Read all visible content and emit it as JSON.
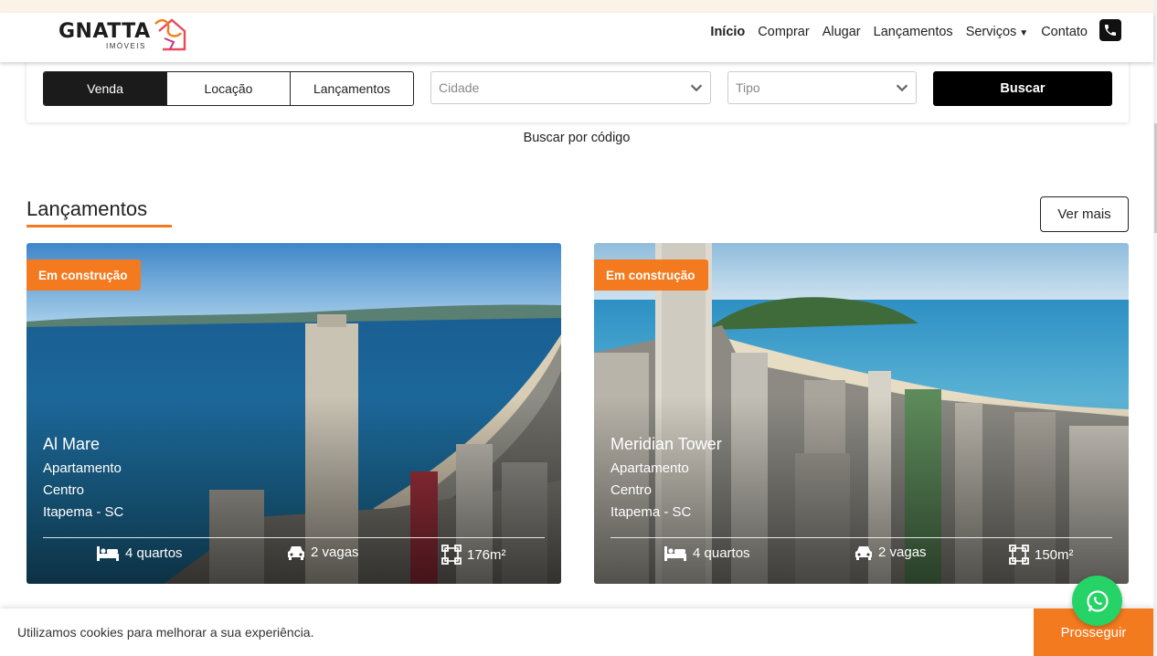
{
  "brand": {
    "name": "GNATTA",
    "sub": "IMÓVEIS",
    "accent": "#f47a1f"
  },
  "nav": {
    "items": [
      {
        "label": "Início",
        "active": true
      },
      {
        "label": "Comprar"
      },
      {
        "label": "Alugar"
      },
      {
        "label": "Lançamentos"
      },
      {
        "label": "Serviços"
      },
      {
        "label": "Contato"
      }
    ]
  },
  "search": {
    "tabs": [
      "Venda",
      "Locação",
      "Lançamentos"
    ],
    "city_placeholder": "Cidade",
    "type_placeholder": "Tipo",
    "submit_label": "Buscar",
    "code_link": "Buscar por código"
  },
  "section": {
    "title": "Lançamentos",
    "more_label": "Ver mais"
  },
  "cards": [
    {
      "badge": "Em construção",
      "name": "Al Mare",
      "type": "Apartamento",
      "district": "Centro",
      "city": "Itapema - SC",
      "rooms": "4 quartos",
      "parking": "2 vagas",
      "area": "176m²"
    },
    {
      "badge": "Em construção",
      "name": "Meridian Tower",
      "type": "Apartamento",
      "district": "Centro",
      "city": "Itapema - SC",
      "rooms": "4 quartos",
      "parking": "2 vagas",
      "area": "150m²"
    }
  ],
  "cookie": {
    "text": "Utilizamos cookies para melhorar a sua experiência.",
    "button": "Prosseguir"
  },
  "icons": [
    "phone-icon",
    "chevron-down-icon",
    "bed-icon",
    "car-icon",
    "area-icon",
    "whatsapp-icon"
  ]
}
